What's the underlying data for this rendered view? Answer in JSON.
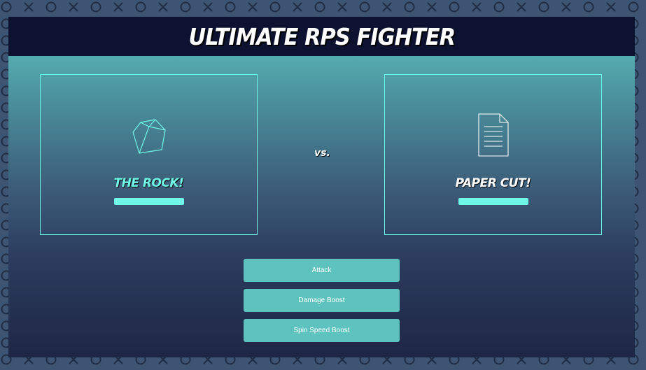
{
  "game": {
    "title": "ULTIMATE RPS FIGHTER",
    "vs_label": "vs."
  },
  "player": {
    "name": "THE ROCK!",
    "icon": "rock-icon",
    "health_fraction": 1.0
  },
  "opponent": {
    "name": "PAPER CUT!",
    "icon": "paper-icon",
    "health_fraction": 1.0
  },
  "actions": {
    "attack_label": "Attack",
    "damage_boost_label": "Damage Boost",
    "spin_speed_boost_label": "Spin Speed Boost"
  },
  "colors": {
    "accent": "#6ff7e8",
    "button": "#5ec3bf",
    "header": "#0c1230",
    "background_pattern": "#3d5573"
  }
}
